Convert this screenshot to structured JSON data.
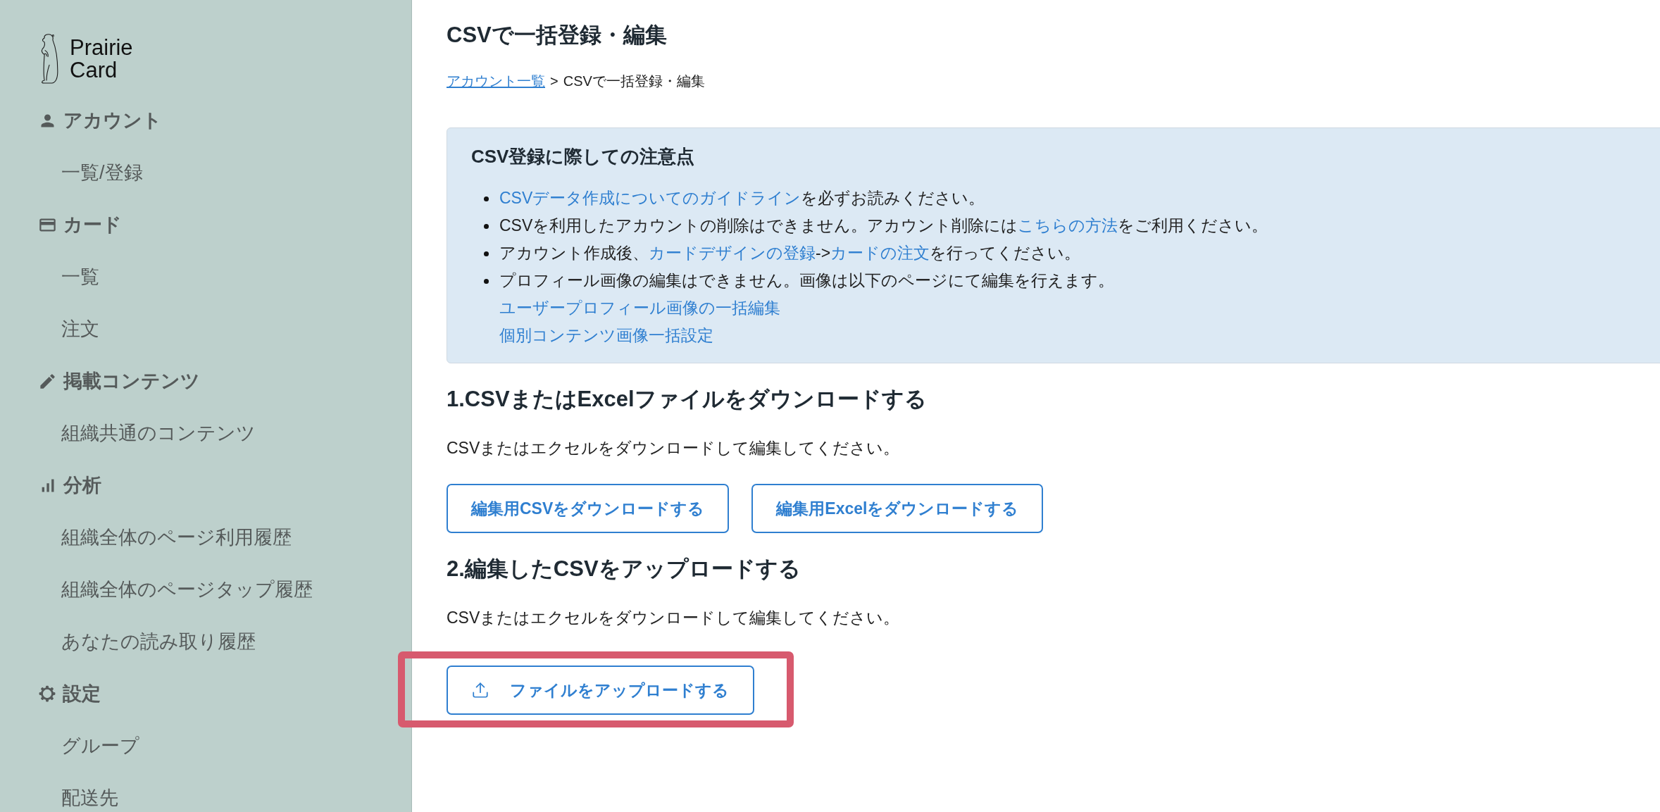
{
  "sidebar": {
    "logo": {
      "lines": [
        "Prairie",
        "Card"
      ]
    },
    "sections": [
      {
        "label": "アカウント",
        "items": [
          {
            "label": "一覧/登録"
          }
        ]
      },
      {
        "label": "カード",
        "items": [
          {
            "label": "一覧"
          },
          {
            "label": "注文"
          }
        ]
      },
      {
        "label": "掲載コンテンツ",
        "items": [
          {
            "label": "組織共通のコンテンツ"
          }
        ]
      },
      {
        "label": "分析",
        "items": [
          {
            "label": "組織全体のページ利用履歴"
          },
          {
            "label": "組織全体のページタップ履歴"
          },
          {
            "label": "あなたの読み取り履歴"
          }
        ]
      },
      {
        "label": "設定",
        "items": [
          {
            "label": "グループ"
          },
          {
            "label": "配送先"
          }
        ]
      }
    ]
  },
  "page": {
    "title": "CSVで一括登録・編集",
    "breadcrumb": {
      "items": [
        {
          "label": "アカウント一覧",
          "kind": "link"
        },
        {
          "label": "CSVで一括登録・編集",
          "kind": "current"
        }
      ],
      "separator": ">"
    }
  },
  "notice": {
    "title": "CSV登録に際しての注意点",
    "items": [
      {
        "parts": [
          {
            "text": "CSVデータ作成についてのガイドライン",
            "kind": "link"
          },
          {
            "text": "を必ずお読みください。",
            "kind": "text"
          }
        ]
      },
      {
        "parts": [
          {
            "text": "CSVを利用したアカウントの削除はできません。アカウント削除には",
            "kind": "text"
          },
          {
            "text": "こちらの方法",
            "kind": "link"
          },
          {
            "text": "をご利用ください。",
            "kind": "text"
          }
        ]
      },
      {
        "parts": [
          {
            "text": "アカウント作成後、",
            "kind": "text"
          },
          {
            "text": "カードデザインの登録",
            "kind": "link"
          },
          {
            "text": "->",
            "kind": "text"
          },
          {
            "text": "カードの注文",
            "kind": "link"
          },
          {
            "text": "を行ってください。",
            "kind": "text"
          }
        ]
      },
      {
        "parts": [
          {
            "text": "プロフィール画像の編集はできません。画像は以下のページにて編集を行えます。",
            "kind": "text"
          }
        ],
        "links": [
          "ユーザープロフィール画像の一括編集",
          "個別コンテンツ画像一括設定"
        ]
      }
    ]
  },
  "sections": [
    {
      "heading": "1.CSVまたはExcelファイルをダウンロードする",
      "description": "CSVまたはエクセルをダウンロードして編集してください。",
      "buttons": [
        {
          "label": "編集用CSVをダウンロードする",
          "kind": "download",
          "highlighted": false
        },
        {
          "label": "編集用Excelをダウンロードする",
          "kind": "download",
          "highlighted": false
        }
      ]
    },
    {
      "heading": "2.編集したCSVをアップロードする",
      "description": "CSVまたはエクセルをダウンロードして編集してください。",
      "buttons": [
        {
          "label": "ファイルをアップロードする",
          "kind": "upload",
          "highlighted": true
        }
      ]
    }
  ]
}
